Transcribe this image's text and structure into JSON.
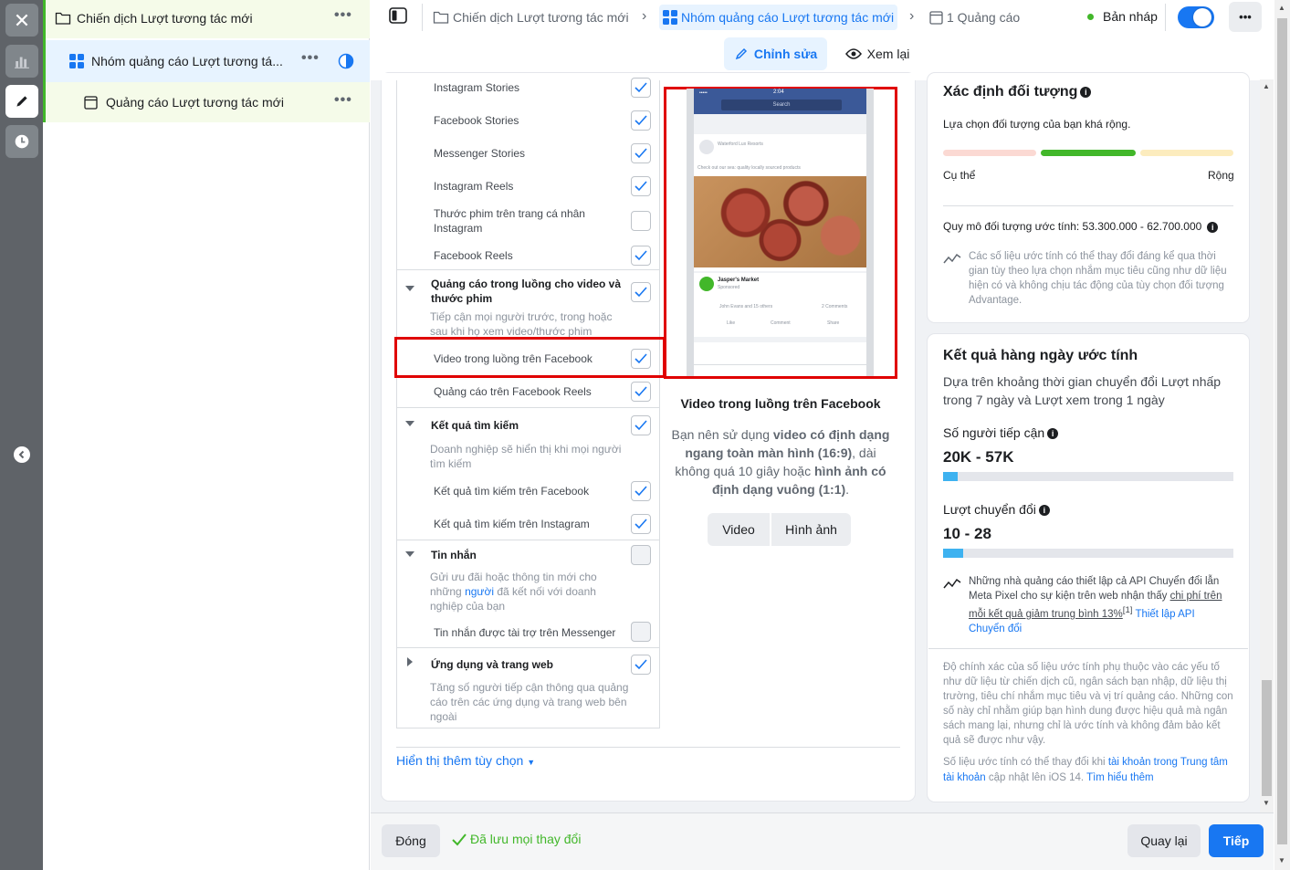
{
  "tree": {
    "campaign": "Chiến dịch Lượt tương tác mới",
    "adset": "Nhóm quảng cáo Lượt tương tá...",
    "ad": "Quảng cáo Lượt tương tác mới",
    "more": "•••"
  },
  "header": {
    "crumb_campaign": "Chiến dịch Lượt tương tác mới",
    "crumb_adset": "Nhóm quảng cáo Lượt tương tác mới",
    "crumb_ad": "1 Quảng cáo",
    "status": "Bản nháp",
    "more": "•••",
    "edit_label": "Chỉnh sửa",
    "review_label": "Xem lại"
  },
  "placements": {
    "instagram_stories": "Instagram Stories",
    "facebook_stories": "Facebook Stories",
    "messenger_stories": "Messenger Stories",
    "instagram_reels": "Instagram Reels",
    "ig_profile_reels": "Thước phim trên trang cá nhân Instagram",
    "facebook_reels": "Facebook Reels",
    "instream_group_title": "Quảng cáo trong luồng cho video và thước phim",
    "instream_group_desc": "Tiếp cận mọi người trước, trong hoặc sau khi họ xem video/thước phim",
    "fb_instream_video": "Video trong luồng trên Facebook",
    "fb_reels_ads": "Quảng cáo trên Facebook Reels",
    "search_group_title": "Kết quả tìm kiếm",
    "search_group_desc": "Doanh nghiệp sẽ hiển thị khi mọi người tìm kiếm",
    "fb_search": "Kết quả tìm kiếm trên Facebook",
    "ig_search": "Kết quả tìm kiếm trên Instagram",
    "messages_group_title": "Tin nhắn",
    "messages_group_desc_a": "Gửi ưu đãi hoặc thông tin mới cho những ",
    "messages_group_desc_link": "người",
    "messages_group_desc_b": " đã kết nối với doanh nghiệp của bạn",
    "messenger_sponsored": "Tin nhắn được tài trợ trên Messenger",
    "apps_group_title": "Ứng dụng và trang web",
    "apps_group_desc": "Tăng số người tiếp cận thông qua quảng cáo trên các ứng dụng và trang web bên ngoài",
    "show_more": "Hiển thị thêm tùy chọn"
  },
  "preview": {
    "title": "Video trong luồng trên Facebook",
    "desc_a": "Bạn nên sử dụng ",
    "desc_b1": "video có định dạng ngang toàn màn hình (16:9)",
    "desc_c": ", dài không quá 10 giây hoặc ",
    "desc_b2": "hình ảnh có định dạng vuông (1:1)",
    "desc_d": ".",
    "btn_video": "Video",
    "btn_image": "Hình ảnh",
    "mock_time": "2:04",
    "mock_search": "Search",
    "mock_page": "Waterford Lux Resorts",
    "mock_post": "Check out our sea: quality locally sourced products",
    "mock_advertiser": "Jasper's Market",
    "mock_sponsored": "Sponsored",
    "mock_reactions": "John Evans and 15 others",
    "mock_comments": "2 Comments",
    "mock_like": "Like",
    "mock_comment": "Comment",
    "mock_share": "Share"
  },
  "audience": {
    "title": "Xác định đối tượng",
    "subtitle": "Lựa chọn đối tượng của bạn khá rộng.",
    "specific": "Cụ thể",
    "broad": "Rộng",
    "size": "Quy mô đối tượng ước tính: 53.300.000 - 62.700.000",
    "note": "Các số liệu ước tính có thể thay đổi đáng kể qua thời gian tùy theo lựa chọn nhắm mục tiêu cũng như dữ liệu hiện có và không chịu tác động của tùy chọn đối tượng Advantage."
  },
  "daily": {
    "title": "Kết quả hàng ngày ước tính",
    "desc": "Dựa trên khoảng thời gian chuyển đổi Lượt nhấp trong 7 ngày và Lượt xem trong 1 ngày",
    "reach_label": "Số người tiếp cận",
    "reach_value": "20K - 57K",
    "reach_fill": 0.05,
    "conv_label": "Lượt chuyển đổi",
    "conv_value": "10 - 28",
    "conv_fill": 0.07,
    "tip_a": "Những nhà quảng cáo thiết lập cả API Chuyển đổi lẫn Meta Pixel cho sự kiện trên web nhận thấy ",
    "tip_u": "chi phí trên mỗi kết quả giảm trung bình 13%",
    "tip_sup": "[1]",
    "tip_link": "Thiết lập API Chuyển đổi",
    "accuracy": "Độ chính xác của số liệu ước tính phụ thuộc vào các yếu tố như dữ liệu từ chiến dịch cũ, ngân sách bạn nhập, dữ liệu thị trường, tiêu chí nhắm mục tiêu và vị trí quảng cáo. Những con số này chỉ nhằm giúp bạn hình dung được hiệu quả mà ngân sách mang lại, nhưng chỉ là ước tính và không đảm bảo kết quả sẽ được như vậy.",
    "ios_a": "Số liệu ước tính có thể thay đổi khi ",
    "ios_link1": "tài khoản trong Trung tâm tài khoản",
    "ios_b": " cập nhật lên iOS 14. ",
    "ios_link2": "Tìm hiểu thêm"
  },
  "footer": {
    "close": "Đóng",
    "saved": "Đã lưu mọi thay đổi",
    "back": "Quay lại",
    "next": "Tiếp"
  },
  "colors": {
    "accent": "#1877f2",
    "highlight": "#e00000",
    "saved": "#42b72a"
  }
}
